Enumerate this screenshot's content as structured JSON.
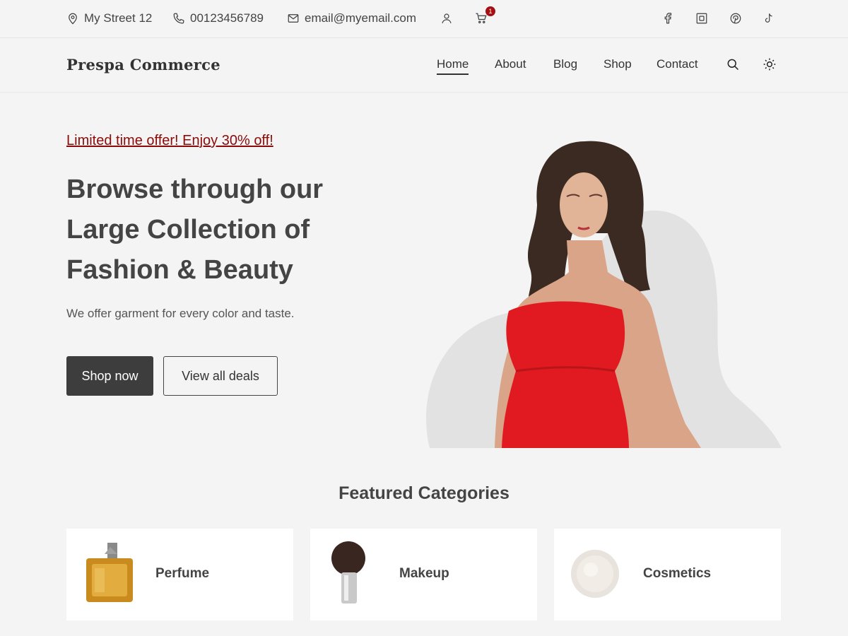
{
  "topbar": {
    "address": "My Street 12",
    "phone": "00123456789",
    "email": "email@myemail.com",
    "cart_count": "1",
    "icons": {
      "address": "location-pin-icon",
      "phone": "phone-icon",
      "email": "envelope-icon",
      "account": "user-icon",
      "cart": "cart-icon",
      "social": [
        "facebook-icon",
        "instagram-icon",
        "pinterest-icon",
        "tiktok-icon"
      ]
    }
  },
  "nav": {
    "brand": "Prespa Commerce",
    "links": [
      "Home",
      "About",
      "Blog",
      "Shop",
      "Contact"
    ],
    "active": "Home",
    "icons": [
      "search-icon",
      "sun-icon"
    ]
  },
  "hero": {
    "offer": "Limited time offer! Enjoy 30% off!",
    "headline": "Browse through our Large Collection of Fashion & Beauty",
    "subtext": "We offer garment for every color and taste.",
    "primary_button": "Shop now",
    "secondary_button": "View all deals"
  },
  "featured": {
    "title": "Featured Categories",
    "categories": [
      {
        "label": "Perfume"
      },
      {
        "label": "Makeup"
      },
      {
        "label": "Cosmetics"
      }
    ]
  },
  "colors": {
    "accent": "#8c0a0a",
    "badge": "#a50f12",
    "dark": "#3d3d3d",
    "background": "#f4f4f4",
    "dress": "#e01a20"
  }
}
